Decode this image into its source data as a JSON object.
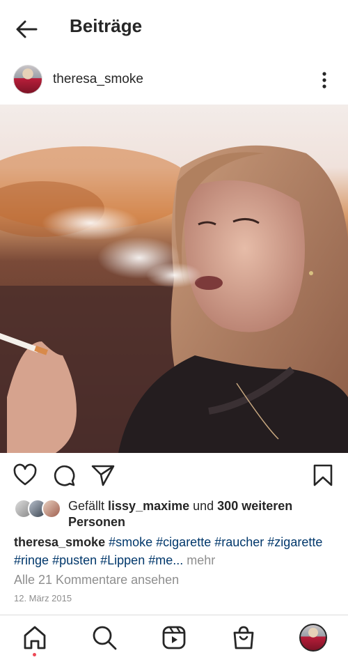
{
  "header": {
    "title": "Beiträge"
  },
  "post": {
    "username": "theresa_smoke",
    "likes": {
      "prefix": "Gefällt ",
      "user": "lissy_maxime",
      "middle": " und ",
      "count_text": "300 weiteren Personen"
    },
    "caption": {
      "user": "theresa_smoke",
      "tags": [
        "#smoke",
        "#cigarette",
        "#raucher",
        "#zigarette",
        "#ringe",
        "#pusten",
        "#Lippen",
        "#me..."
      ],
      "more": " mehr"
    },
    "comments_link": "Alle 21 Kommentare ansehen",
    "date": "12. März 2015"
  },
  "icons": {
    "back": "arrow-left-icon",
    "more": "vertical-dots-icon",
    "like": "heart-icon",
    "comment": "comment-icon",
    "share": "send-icon",
    "save": "bookmark-icon",
    "home": "home-icon",
    "search": "search-icon",
    "reels": "reels-icon",
    "shop": "shop-bag-icon"
  },
  "colors": {
    "hashtag": "#00376b",
    "muted": "#8e8e8e",
    "notification_dot": "#ed4956"
  }
}
